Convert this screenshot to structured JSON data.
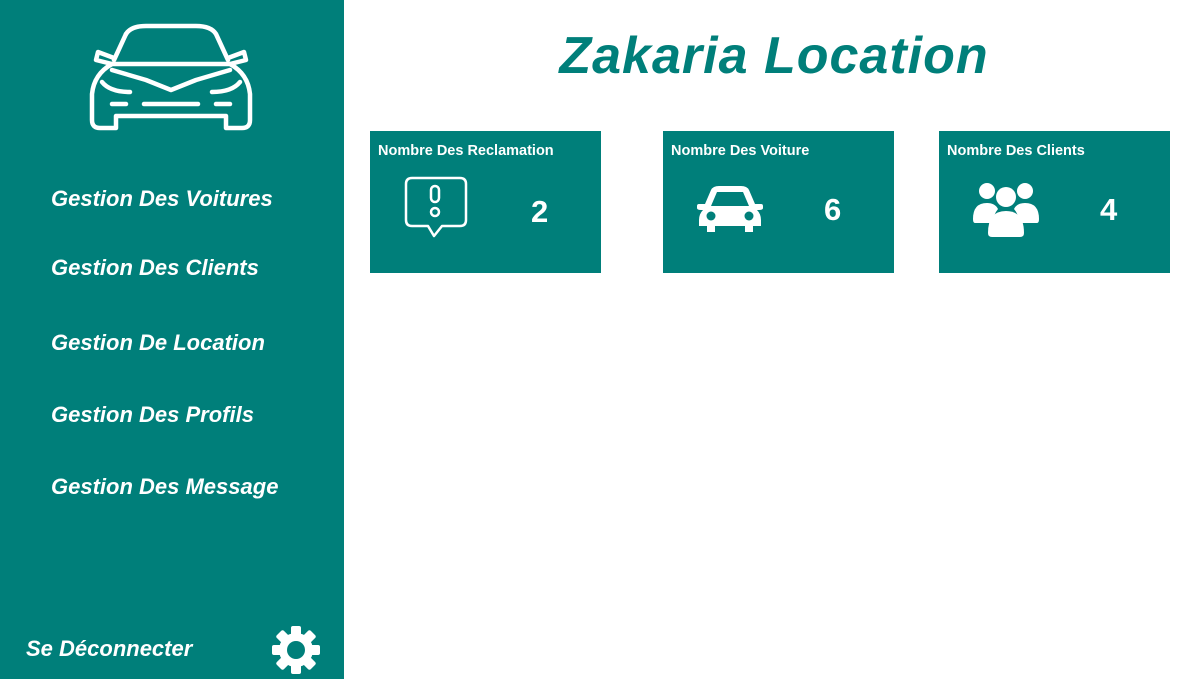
{
  "app": {
    "title": "Zakaria Location",
    "logo_icon": "car-front-outline-icon"
  },
  "sidebar": {
    "items": [
      {
        "label": "Gestion Des Voitures"
      },
      {
        "label": "Gestion Des Clients"
      },
      {
        "label": "Gestion De Location"
      },
      {
        "label": "Gestion Des Profils"
      },
      {
        "label": "Gestion Des Message"
      }
    ],
    "logout_label": "Se Déconnecter",
    "settings_icon": "gear-icon"
  },
  "cards": [
    {
      "title": "Nombre Des Reclamation",
      "value": "2",
      "icon": "alert-message-icon"
    },
    {
      "title": "Nombre Des Voiture",
      "value": "6",
      "icon": "car-icon"
    },
    {
      "title": "Nombre Des Clients",
      "value": "4",
      "icon": "users-group-icon"
    }
  ],
  "colors": {
    "primary": "#007f7a",
    "background": "#ffffff",
    "text_on_primary": "#ffffff"
  }
}
